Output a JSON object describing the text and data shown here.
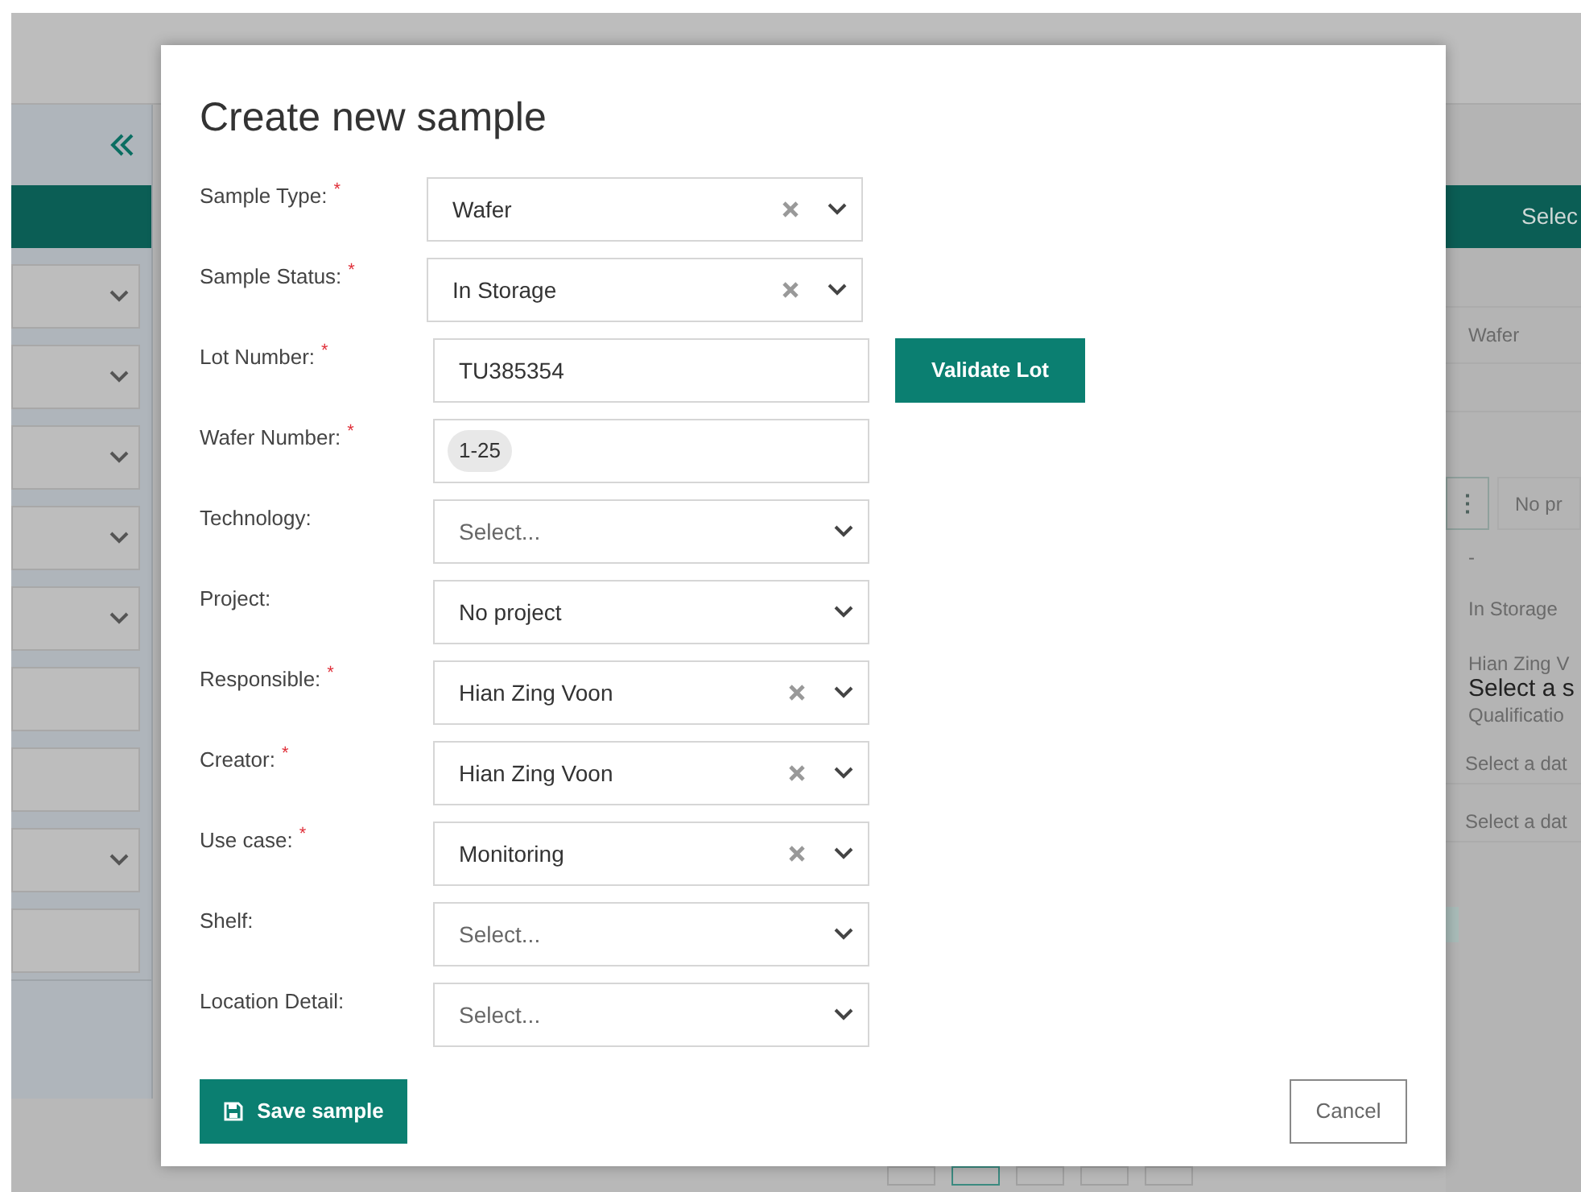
{
  "background": {
    "left_panel": {
      "rows": [
        {
          "kind": "select"
        },
        {
          "kind": "select"
        },
        {
          "kind": "select"
        },
        {
          "kind": "select"
        },
        {
          "kind": "select"
        },
        {
          "kind": "input"
        },
        {
          "kind": "input"
        },
        {
          "kind": "select"
        },
        {
          "kind": "input"
        }
      ]
    },
    "right_panel": {
      "header": "Selec",
      "type_value": "Wafer",
      "more_icon": "⋮",
      "project": "No pr",
      "dash": "-",
      "status": "In Storage",
      "responsible": "Hian Zing V",
      "prompt": "Select a s",
      "use_case": "Qualificatio",
      "dates": [
        "Select a dat",
        "Select a dat"
      ]
    },
    "pagination": [
      {
        "selected": false
      },
      {
        "selected": true
      },
      {
        "selected": false
      },
      {
        "selected": false
      },
      {
        "selected": false
      }
    ]
  },
  "dialog": {
    "title": "Create new sample",
    "fields": [
      {
        "label": "Sample Type:",
        "required_mark": "*",
        "kind": "select",
        "value": "Wafer",
        "clearable": true
      },
      {
        "label": "Sample Status:",
        "required_mark": "*",
        "kind": "select",
        "value": "In Storage",
        "clearable": true
      },
      {
        "label": "Lot Number:",
        "required_mark": "*",
        "kind": "text",
        "value": "TU385354",
        "action": "Validate Lot"
      },
      {
        "label": "Wafer Number:",
        "required_mark": "*",
        "kind": "tags",
        "tags": [
          "1-25"
        ]
      },
      {
        "label": "Technology:",
        "kind": "select",
        "placeholder": "Select...",
        "clearable": false
      },
      {
        "label": "Project:",
        "kind": "select",
        "value": "No project",
        "clearable": false
      },
      {
        "label": "Responsible:",
        "required_mark": "*",
        "kind": "select",
        "value": "Hian Zing Voon",
        "clearable": true
      },
      {
        "label": "Creator:",
        "required_mark": "*",
        "kind": "select",
        "value": "Hian Zing Voon",
        "clearable": true
      },
      {
        "label": "Use case:",
        "required_mark": "*",
        "kind": "select",
        "value": "Monitoring",
        "clearable": true
      },
      {
        "label": "Shelf:",
        "kind": "select",
        "placeholder": "Select...",
        "clearable": false
      },
      {
        "label": "Location Detail:",
        "kind": "select",
        "placeholder": "Select...",
        "clearable": false
      }
    ],
    "save_button": "Save sample",
    "cancel_button": "Cancel"
  }
}
